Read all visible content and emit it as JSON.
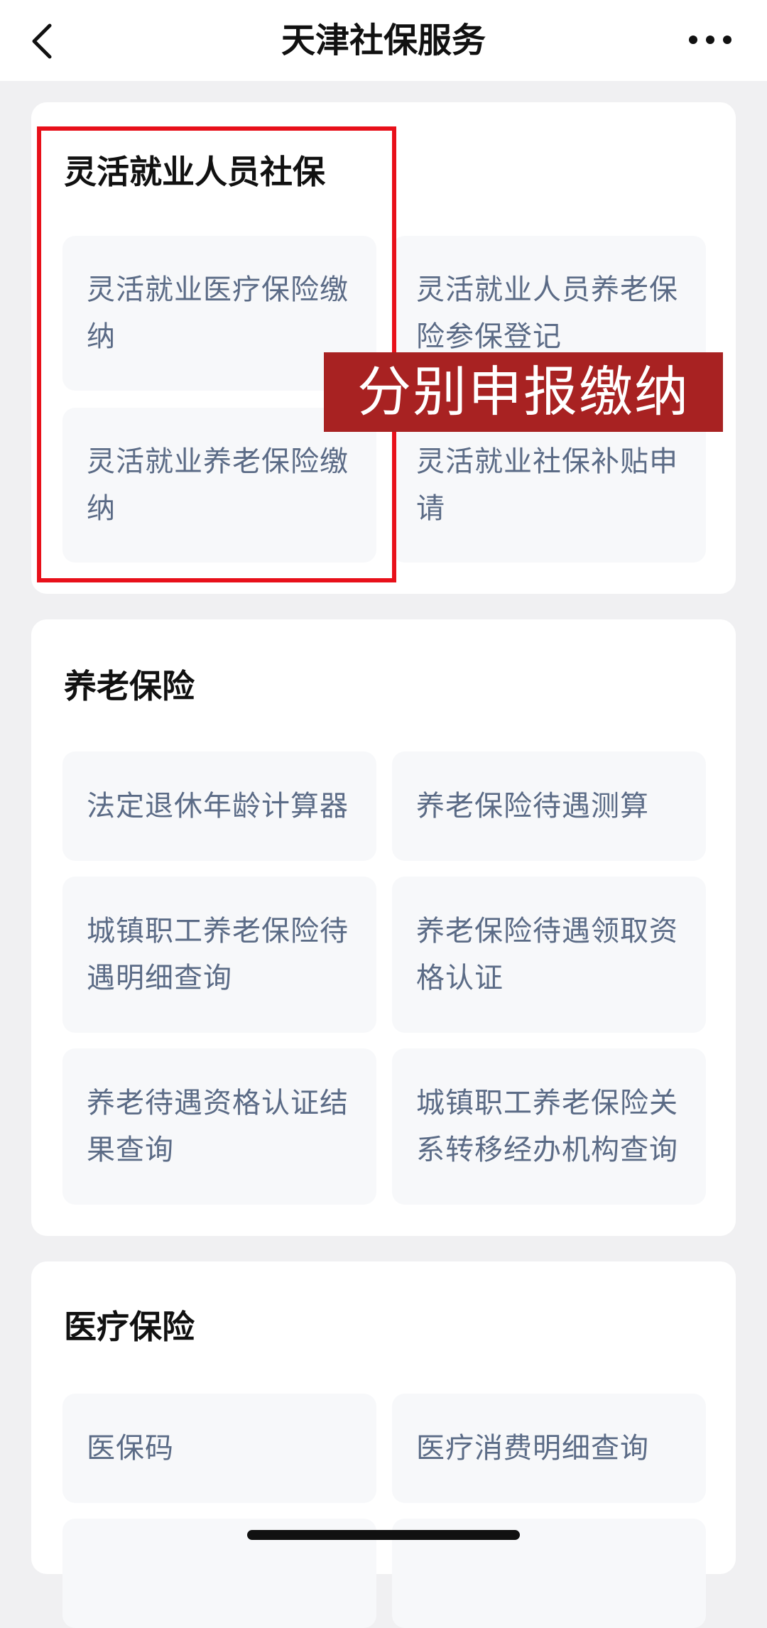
{
  "header": {
    "title": "天津社保服务"
  },
  "sections": [
    {
      "title": "灵活就业人员社保",
      "items": [
        "灵活就业医疗保险缴纳",
        "灵活就业人员养老保险参保登记",
        "灵活就业养老保险缴纳",
        "灵活就业社保补贴申请"
      ]
    },
    {
      "title": "养老保险",
      "items": [
        "法定退休年龄计算器",
        "养老保险待遇测算",
        "城镇职工养老保险待遇明细查询",
        "养老保险待遇领取资格认证",
        "养老待遇资格认证结果查询",
        "城镇职工养老保险关系转移经办机构查询"
      ]
    },
    {
      "title": "医疗保险",
      "items": [
        "医保码",
        "医疗消费明细查询"
      ]
    }
  ],
  "overlay": {
    "banner_text": "分别申报缴纳",
    "highlight_color": "#e8101a",
    "banner_color": "#a82222"
  }
}
